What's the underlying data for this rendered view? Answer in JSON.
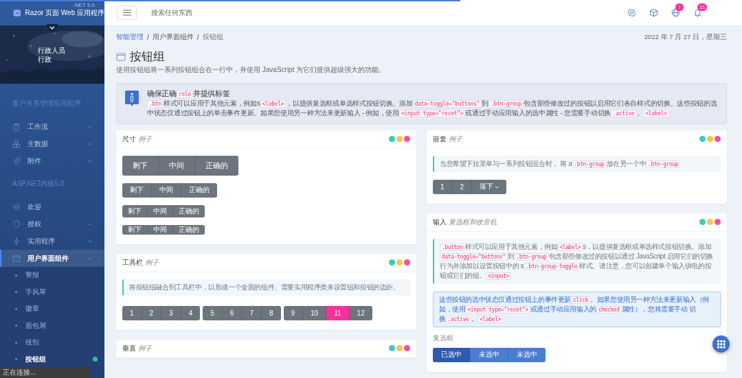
{
  "loading_bar": {
    "level": 0.62
  },
  "brand": {
    "name": "Razor 页面 Web 应用程序",
    "version": ".NET 5.0"
  },
  "user": {
    "name": "行政人员",
    "role": "行政"
  },
  "sidebar": {
    "sections": [
      {
        "label": "客户关系管理应用程序",
        "items": [
          {
            "label": "工作流",
            "selected": false,
            "expanded": false
          },
          {
            "label": "主数据",
            "selected": false,
            "expanded": false
          },
          {
            "label": "附件",
            "selected": false,
            "expanded": false
          }
        ]
      },
      {
        "label": "ASP.NET内核5.0",
        "items": [
          {
            "label": "欢迎",
            "selected": false
          },
          {
            "label": "授权",
            "selected": false,
            "expanded": false
          },
          {
            "label": "实用程序",
            "selected": false,
            "expanded": false
          },
          {
            "label": "用户界面组件",
            "selected": true,
            "expanded": true,
            "children": [
              {
                "label": "警报",
                "selected": false,
                "dot": false
              },
              {
                "label": "手风琴",
                "selected": false,
                "dot": false
              },
              {
                "label": "徽章",
                "selected": false,
                "dot": false
              },
              {
                "label": "面包屑",
                "selected": false,
                "dot": false
              },
              {
                "label": "纽扣",
                "selected": false,
                "dot": false
              },
              {
                "label": "按钮组",
                "selected": true,
                "dot": true
              }
            ]
          }
        ]
      }
    ]
  },
  "status_text": "正在连接...",
  "search": {
    "placeholder": "搜索任何东西"
  },
  "header_badges": {
    "globe": "!",
    "bell": "11"
  },
  "breadcrumb_separators": [
    "/",
    "/"
  ],
  "breadcrumbs": [
    {
      "label": "智能管理",
      "kind": "link"
    },
    {
      "label": "用户界面组件",
      "kind": "text"
    },
    {
      "label": "按钮组",
      "kind": "current"
    }
  ],
  "date": "2022 年 7 月 27 日，星期三",
  "page": {
    "title": "按钮组",
    "subtitle": "使用按钮组将一系列按钮组合在一行中，并使用 JavaScript 为它们提供超级强大的功能。"
  },
  "alert": {
    "title": [
      {
        "kind": "text",
        "text": "确保正确"
      },
      {
        "kind": "code",
        "text": "role"
      },
      {
        "kind": "text",
        "text": "并提供标签"
      }
    ],
    "body": [
      {
        "kind": "code",
        "text": ".btn"
      },
      {
        "kind": "text",
        "text": "样式可以应用于其他元素，例如s"
      },
      {
        "kind": "code",
        "text": "<label>"
      },
      {
        "kind": "text",
        "text": "，以提供复选框或单选样式按钮切换。添加"
      },
      {
        "kind": "code",
        "text": "data-toggle=\"buttons\""
      },
      {
        "kind": "text",
        "text": "到"
      },
      {
        "kind": "code",
        "text": ".btn-group"
      },
      {
        "kind": "text",
        "text": "包含那些修改过的按钮以启用它们各自样式的切换。这些按钮的选中状态仅通过按钮上的单击事件更新。如果您使用另一种方法来更新输入 - 例如，使用"
      },
      {
        "kind": "code",
        "text": "<input type=\"reset\">"
      },
      {
        "kind": "text",
        "text": "或通过手动应用输入的选中属性 - 您需要手动切换"
      },
      {
        "kind": "code",
        "text": ".active"
      },
      {
        "kind": "text",
        "text": "。"
      },
      {
        "kind": "code",
        "text": "<label>"
      }
    ]
  },
  "left_cards": [
    {
      "kind": "sizing",
      "title": "尺寸",
      "subtitle": "例子",
      "groups": [
        {
          "kind": "lg",
          "buttons": [
            "剩下",
            "中间",
            "正确的"
          ]
        },
        {
          "kind": "md",
          "buttons": [
            "剩下",
            "中间",
            "正确的"
          ]
        },
        {
          "kind": "sm",
          "buttons": [
            "剩下",
            "中间",
            "正确的"
          ]
        },
        {
          "kind": "xs",
          "buttons": [
            "剩下",
            "中间",
            "正确的"
          ]
        }
      ]
    },
    {
      "kind": "toolbar",
      "title": "工具栏",
      "subtitle": "例子",
      "note": [
        {
          "kind": "text",
          "text": "将按钮组融合到工具栏中，以形成一个全面的组件。需要实用程序类来设置组和按钮的边距。"
        }
      ],
      "groups": [
        [
          {
            "label": "1",
            "selected": false
          },
          {
            "label": "2",
            "selected": false
          },
          {
            "label": "3",
            "selected": false
          },
          {
            "label": "4",
            "selected": false
          }
        ],
        [
          {
            "label": "5",
            "selected": false
          },
          {
            "label": "6",
            "selected": false
          },
          {
            "label": "7",
            "selected": false
          },
          {
            "label": "8",
            "selected": false
          }
        ],
        [
          {
            "label": "9",
            "selected": false
          },
          {
            "label": "10",
            "selected": false
          },
          {
            "label": "11",
            "selected": true
          },
          {
            "label": "12",
            "selected": false
          }
        ]
      ]
    },
    {
      "kind": "header_only",
      "title": "垂直",
      "subtitle": "例子"
    }
  ],
  "right_cards": [
    {
      "kind": "nesting",
      "title": "嵌套",
      "subtitle": "例子",
      "note": [
        {
          "kind": "text",
          "text": "当您希望下拉菜单与一系列按钮混合时， 将 a"
        },
        {
          "kind": "code",
          "text": ".btn-group"
        },
        {
          "kind": "text",
          "text": "放在另一个中"
        },
        {
          "kind": "code",
          "text": ".btn-group"
        }
      ],
      "buttons": [
        {
          "label": "1",
          "kind": "plain"
        },
        {
          "label": "2",
          "kind": "plain"
        },
        {
          "label": "落下",
          "kind": "dropdown"
        }
      ]
    },
    {
      "kind": "input",
      "title": "输入",
      "subtitle": "复选框和收音机",
      "note": [
        {
          "kind": "code",
          "text": ".button"
        },
        {
          "kind": "text",
          "text": "样式可以应用于其他元素，例如"
        },
        {
          "kind": "code",
          "text": "<label>"
        },
        {
          "kind": "text",
          "text": "s，以提供复选框或单选样式按钮切换。添加"
        },
        {
          "kind": "code",
          "text": "data-toggle=\"buttons\""
        },
        {
          "kind": "text",
          "text": "到"
        },
        {
          "kind": "code",
          "text": ".btn-group"
        },
        {
          "kind": "text",
          "text": "包含那些修改过的按钮以通过 JavaScript 启用它们的切换行为并添加以设置按钮中的 s"
        },
        {
          "kind": "code",
          "text": ".btn-group-toggle"
        },
        {
          "kind": "text",
          "text": "样式。请注意，您可以创建单个输入供电的按钮或它们的组。"
        },
        {
          "kind": "code",
          "text": "<input>"
        }
      ],
      "info": [
        {
          "kind": "text",
          "text": "这些按钮的选中状态仅通过按钮上的事件更新"
        },
        {
          "kind": "code",
          "text": "click"
        },
        {
          "kind": "text",
          "text": "。如果您使用另一种方法来更新输入（例如，使用"
        },
        {
          "kind": "code",
          "text": "<input type=\"reset\">"
        },
        {
          "kind": "text",
          "text": "或通过手动应用输入的"
        },
        {
          "kind": "code",
          "text": "checked"
        },
        {
          "kind": "text",
          "text": "属性），您将需要手动 切换"
        },
        {
          "kind": "code",
          "text": ".active"
        },
        {
          "kind": "text",
          "text": "。"
        },
        {
          "kind": "code",
          "text": "<label>"
        }
      ],
      "group_label": "复选框",
      "buttons": [
        {
          "label": "已选中",
          "selected": true
        },
        {
          "label": "未选中",
          "selected": false
        },
        {
          "label": "未选中",
          "selected": false
        }
      ]
    }
  ]
}
